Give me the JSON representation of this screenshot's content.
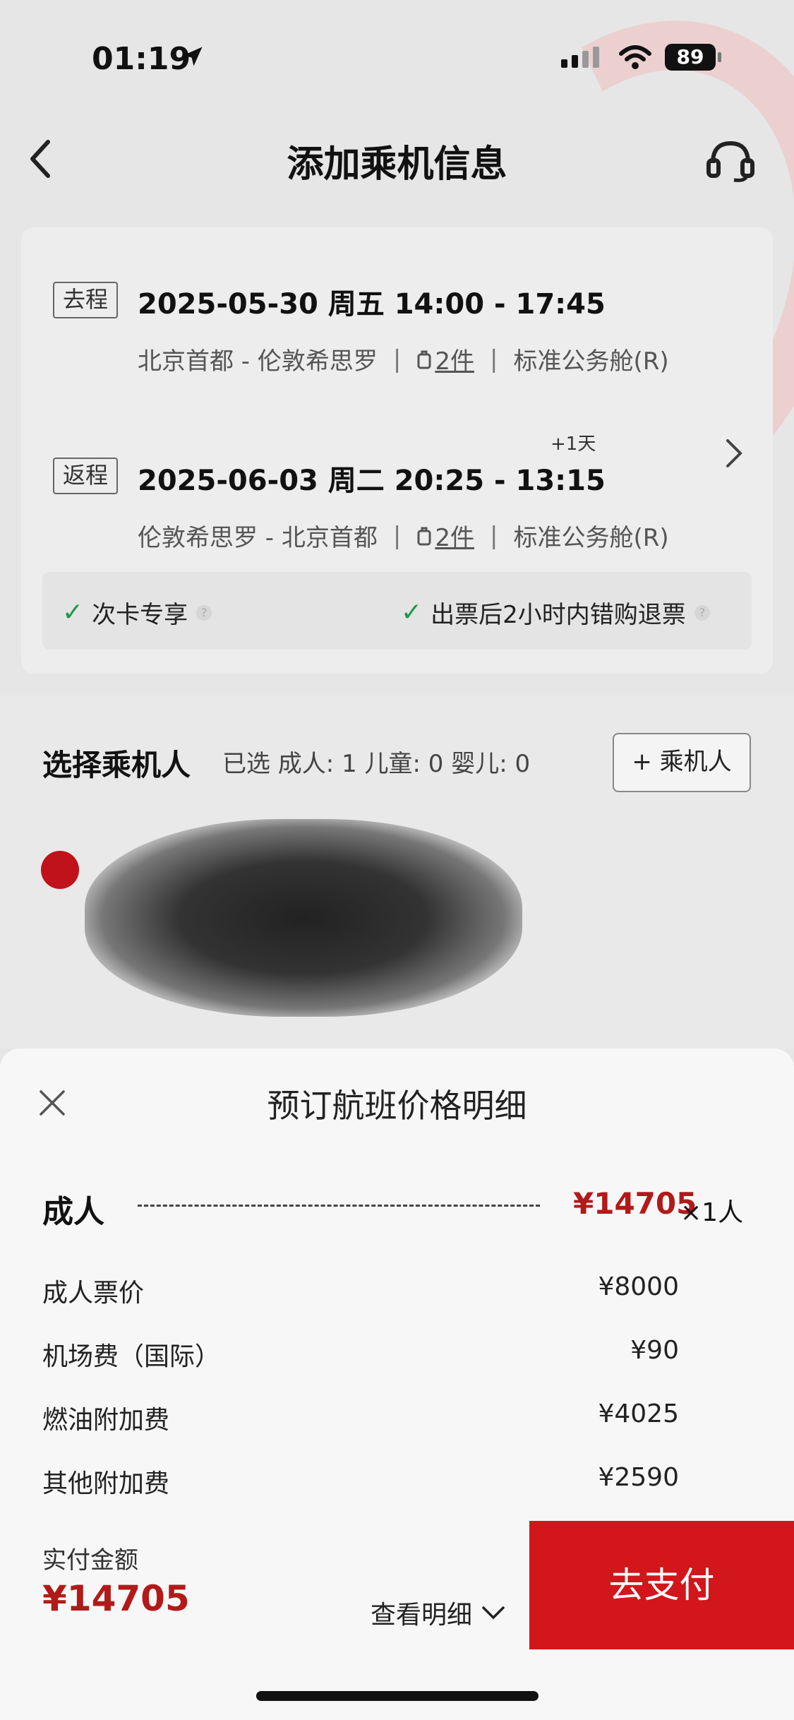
{
  "status_bar": {
    "time": "01:19",
    "battery": "89"
  },
  "nav": {
    "title": "添加乘机信息"
  },
  "outbound": {
    "tag": "去程",
    "date_time": "2025-05-30 周五  14:00 - 17:45",
    "route": "北京首都 - 伦敦希思罗",
    "baggage": "2件",
    "cabin": "标准公务舱(R)"
  },
  "return": {
    "tag": "返程",
    "date_time": "2025-06-03 周二  20:25 - 13:15",
    "plus_day": "+1天",
    "route": "伦敦希思罗 - 北京首都",
    "baggage": "2件",
    "cabin": "标准公务舱(R)"
  },
  "perks": [
    {
      "label": "次卡专享"
    },
    {
      "label": "出票后2小时内错购退票"
    }
  ],
  "passengers": {
    "title": "选择乘机人",
    "selected": "已选 成人: 1  儿童: 0  婴儿: 0",
    "add_button": "+ 乘机人"
  },
  "sheet": {
    "title": "预订航班价格明细",
    "adult_label": "成人",
    "adult_price": "¥14705",
    "adult_qty": "×1人",
    "items": [
      {
        "label": "成人票价",
        "value": "¥8000"
      },
      {
        "label": "机场费（国际）",
        "value": "¥90"
      },
      {
        "label": "燃油附加费",
        "value": "¥4025"
      },
      {
        "label": "其他附加费",
        "value": "¥2590"
      }
    ]
  },
  "pay": {
    "label": "实付金额",
    "total": "¥14705",
    "detail_link": "查看明细",
    "button": "去支付"
  },
  "colors": {
    "accent_red": "#d2161b",
    "price_red": "#b21a1a",
    "check_green": "#1a9a4a"
  }
}
